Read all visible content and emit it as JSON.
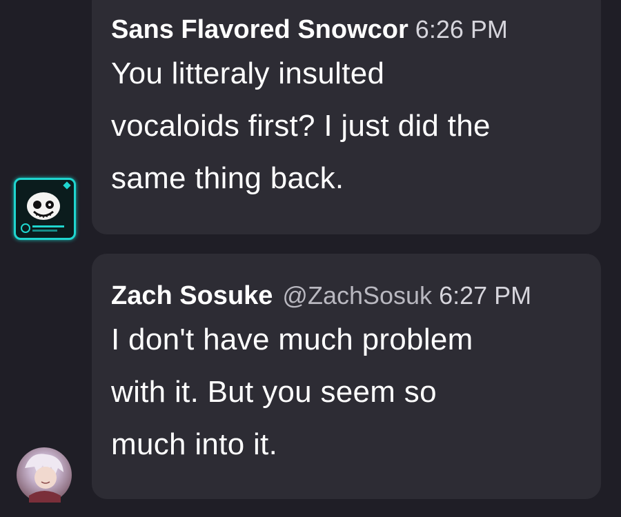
{
  "messages": [
    {
      "author": "Sans Flavored Snowcor",
      "handle": "",
      "time": "6:26 PM",
      "lines": [
        "You litteraly insulted",
        "vocaloids first? I just did the",
        "same thing back."
      ],
      "avatar_icon": "sans-skull-avatar-icon"
    },
    {
      "author": "Zach Sosuke",
      "handle": "@ZachSosuk",
      "time": "6:27 PM",
      "lines": [
        "I don't have much problem",
        "with it. But you seem so",
        "much into it."
      ],
      "avatar_icon": "anime-character-avatar-icon"
    }
  ],
  "colors": {
    "background": "#1f1e26",
    "bubble": "#2d2c34",
    "text": "#ffffff",
    "muted": "#b9b8c0",
    "accent_cyan": "#1fd6cf"
  }
}
